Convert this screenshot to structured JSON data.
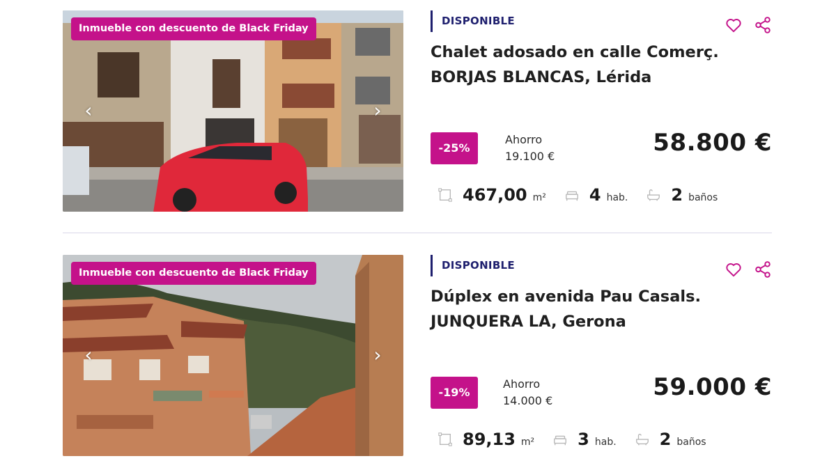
{
  "listings": [
    {
      "promo_badge": "Inmueble con descuento de Black Friday",
      "status": "DISPONIBLE",
      "title_line1": "Chalet adosado en calle Comerç.",
      "title_line2": "BORJAS BLANCAS, Lérida",
      "discount": "-25%",
      "savings_label": "Ahorro",
      "savings_amount": "19.100 €",
      "price": "58.800 €",
      "area": "467,00",
      "area_unit": "m²",
      "rooms": "4",
      "rooms_unit": "hab.",
      "baths": "2",
      "baths_unit": "baños"
    },
    {
      "promo_badge": "Inmueble con descuento de Black Friday",
      "status": "DISPONIBLE",
      "title_line1": "Dúplex en avenida Pau Casals.",
      "title_line2": "JUNQUERA LA, Gerona",
      "discount": "-19%",
      "savings_label": "Ahorro",
      "savings_amount": "14.000 €",
      "price": "59.000 €",
      "area": "89,13",
      "area_unit": "m²",
      "rooms": "3",
      "rooms_unit": "hab.",
      "baths": "2",
      "baths_unit": "baños"
    }
  ],
  "icons": {
    "favorite": "heart-icon",
    "share": "share-icon",
    "prev": "chevron-left-icon",
    "next": "chevron-right-icon",
    "area": "area-icon",
    "rooms": "bed-icon",
    "baths": "bathtub-icon"
  },
  "colors": {
    "accent": "#c4128a",
    "status": "#1e1f6e"
  }
}
